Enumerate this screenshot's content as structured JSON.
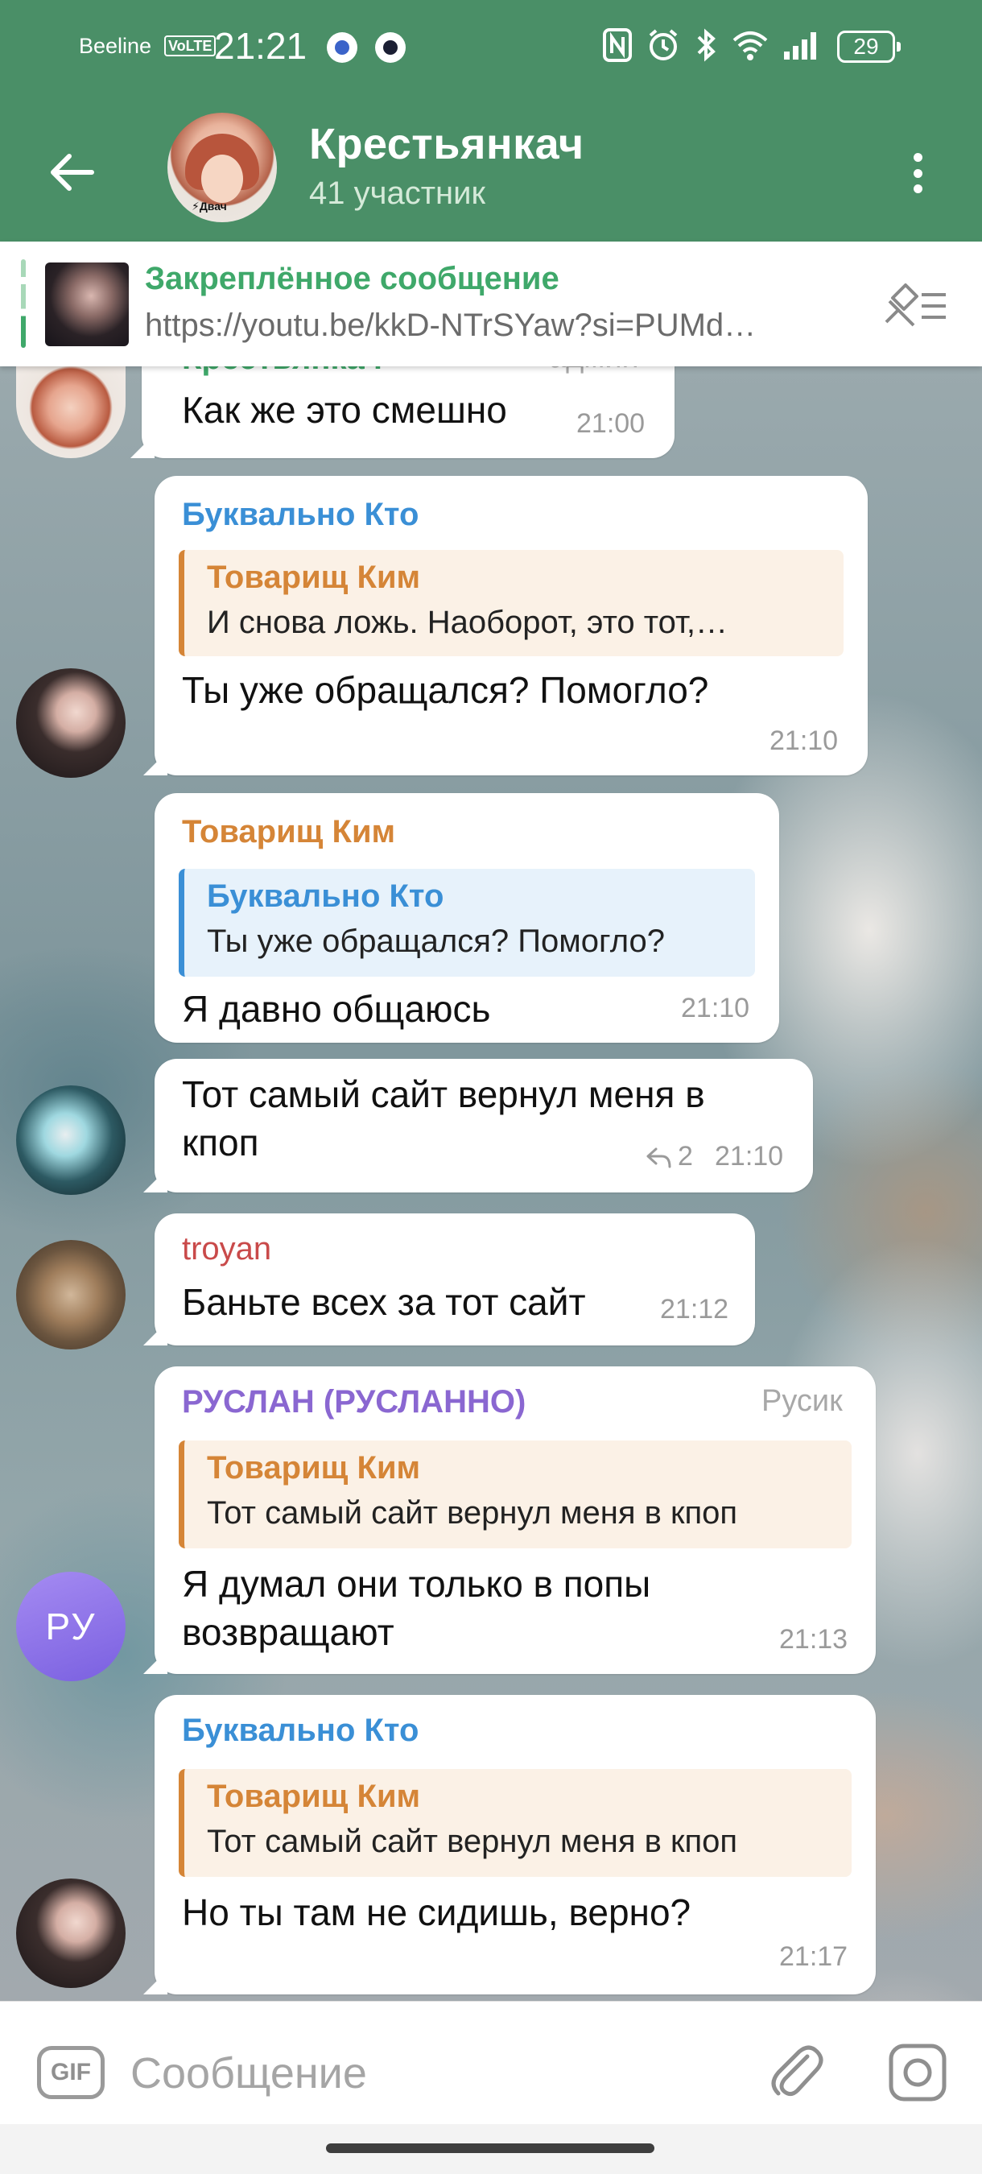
{
  "status_bar": {
    "carrier": "Beeline",
    "volte": "VoLTE",
    "time": "21:21",
    "battery": "29"
  },
  "header": {
    "title": "Крестьянкач",
    "subtitle": "41 участник",
    "avatar_tag": "⚡Двач"
  },
  "pinned": {
    "title": "Закреплённое сообщение",
    "text": "https://youtu.be/kkD-NTrSYaw?si=PUMd…"
  },
  "messages": [
    {
      "sender": "Крестьянкач",
      "role": "админ",
      "text": "Как же это смешно",
      "time": "21:00",
      "avatar_tag": "⚡Двач"
    },
    {
      "sender": "Буквально Кто",
      "reply": {
        "name": "Товарищ Ким",
        "text": "И снова ложь. Наоборот, это тот,…"
      },
      "text": "Ты уже обращался? Помогло?",
      "time": "21:10"
    },
    {
      "sender": "Товарищ Ким",
      "reply": {
        "name": "Буквально Кто",
        "text": "Ты уже обращался? Помогло?"
      },
      "text": "Я давно общаюсь",
      "time": "21:10"
    },
    {
      "text_line1": "Тот самый сайт вернул меня в",
      "text_line2": "кпоп",
      "replies": "2",
      "time": "21:10"
    },
    {
      "sender": "troyan",
      "text": "Баньте всех за тот сайт",
      "time": "21:12"
    },
    {
      "sender": "РУСЛАН (РУСЛАННО)",
      "role": "Русик",
      "avatar_initials": "РУ",
      "reply": {
        "name": "Товарищ Ким",
        "text": "Тот самый сайт вернул меня в кпоп"
      },
      "text_line1": "Я думал они только в попы",
      "text_line2": "возвращают",
      "time": "21:13"
    },
    {
      "sender": "Буквально Кто",
      "reply": {
        "name": "Товарищ Ким",
        "text": "Тот самый сайт вернул меня в кпоп"
      },
      "text": "Но ты там не сидишь, верно?",
      "time": "21:17"
    }
  ],
  "composer": {
    "gif_label": "GIF",
    "placeholder": "Сообщение"
  },
  "colors": {
    "header_green": "#4a8f67",
    "name_blue": "#3a8fd6",
    "name_orange": "#d58537",
    "name_red": "#c94a4a",
    "name_purple": "#8a67d1",
    "pin_green": "#3fa86a"
  }
}
